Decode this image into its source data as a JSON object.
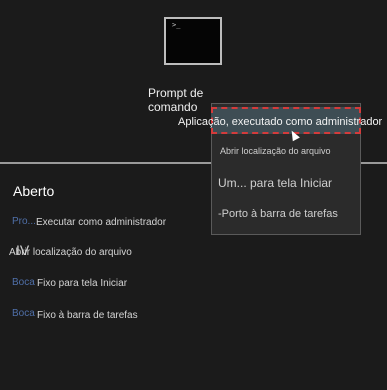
{
  "app": {
    "name": "Prompt de comando",
    "tile_glyph": ">_"
  },
  "context_menu": {
    "highlighted_label": "Aplicação, executado como administrador",
    "open_location": "Abrir localização do arquivo",
    "pin_start_overlay": "Um... para tela Iniciar",
    "pin_taskbar_overlay": "-Porto à barra de tarefas"
  },
  "jumplist": {
    "heading": "Aberto",
    "items": [
      {
        "ghost": "Pro...",
        "label": "Executar como administrador"
      },
      {
        "ghost": "IV",
        "label": "Abrir localização do arquivo"
      },
      {
        "ghost": "Boca",
        "label": "Fixo para tela Iniciar"
      },
      {
        "ghost": "Boca",
        "label": "Fixo à barra de tarefas"
      }
    ]
  },
  "colors": {
    "background": "#1b1b1b",
    "highlight_border": "#d43b3b",
    "highlight_fill": "#3e4d54",
    "menu_background": "#2b2b2b"
  }
}
